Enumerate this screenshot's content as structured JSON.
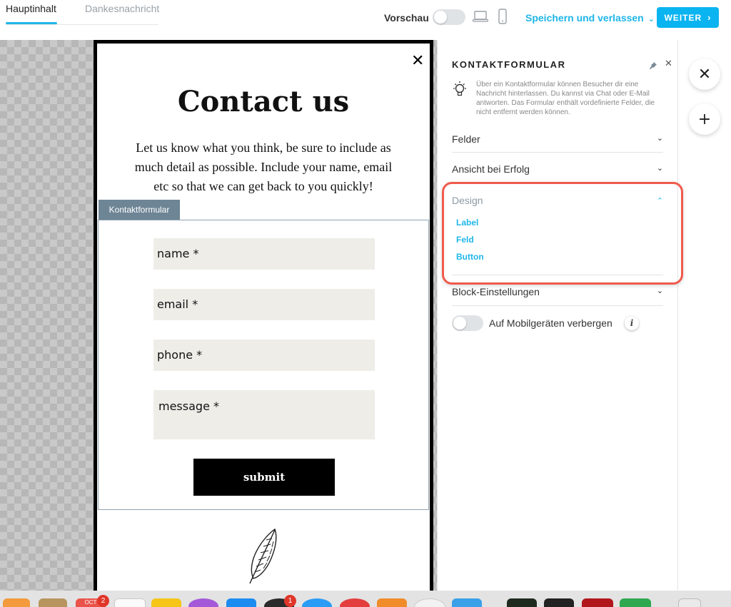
{
  "tabs": {
    "main": "Hauptinhalt",
    "thanks": "Dankesnachricht"
  },
  "topbar": {
    "preview_label": "Vorschau",
    "save_label": "Speichern und verlassen",
    "next_label": "WEITER"
  },
  "popup": {
    "title": "Contact us",
    "text": "Let us know what you think, be sure to include as much detail as possible. Include your name, email etc so that we can get back to you quickly!",
    "block_tag": "Kontaktformular",
    "fields": [
      "name *",
      "email *",
      "phone *",
      "message *"
    ],
    "submit_label": "submit"
  },
  "panel": {
    "title": "KONTAKTFORMULAR",
    "info": "Über ein Kontaktformular können Besucher dir eine Nachricht hinterlassen. Du kannst via Chat oder E-Mail antworten. Das Formular enthält vordefinierte Felder, die nicht entfernt werden können.",
    "sections": [
      "Felder",
      "Ansicht bei Erfolg",
      "Design",
      "Block-Einstellungen"
    ],
    "design_items": [
      "Label",
      "Feld",
      "Button"
    ],
    "mobile_hide_label": "Auf Mobilgeräten verbergen"
  },
  "dock": {
    "calendar_badge": "2",
    "chat_badge": "1",
    "calendar_label": "OCT"
  },
  "colors": {
    "accent": "#1fb6e8",
    "highlight": "#ef5a4c",
    "field_bg": "#eeede8"
  }
}
